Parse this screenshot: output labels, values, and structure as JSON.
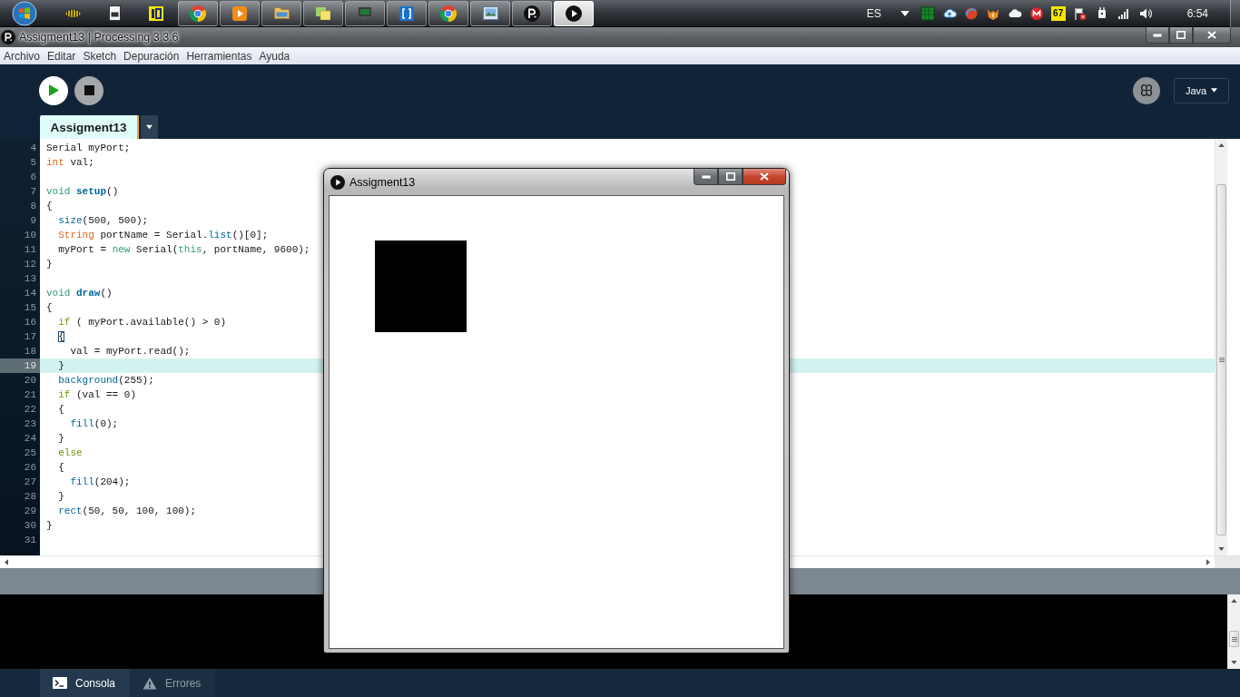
{
  "taskbar": {
    "apps": [
      {
        "running": false,
        "selected": false
      },
      {
        "running": false,
        "selected": false
      },
      {
        "running": false,
        "selected": false
      },
      {
        "running": true,
        "selected": false
      },
      {
        "running": true,
        "selected": false
      },
      {
        "running": true,
        "selected": false
      },
      {
        "running": true,
        "selected": false
      },
      {
        "running": true,
        "selected": false
      },
      {
        "running": true,
        "selected": false
      },
      {
        "running": true,
        "selected": false
      },
      {
        "running": true,
        "selected": false
      },
      {
        "running": true,
        "selected": false
      },
      {
        "running": true,
        "selected": true
      }
    ],
    "tray": {
      "language": "ES",
      "counter": "67",
      "clock": "6:54"
    }
  },
  "window": {
    "title": "Assigment13 | Processing 3.3.6"
  },
  "menu": [
    "Archivo",
    "Editar",
    "Sketch",
    "Depuración",
    "Herramientas",
    "Ayuda"
  ],
  "toolbar": {
    "mode": "Java"
  },
  "tabs": [
    {
      "label": "Assigment13",
      "selected": true
    }
  ],
  "editor": {
    "lines": [
      {
        "number": "4",
        "current": false,
        "tokens": [
          {
            "text": "Serial myPort;",
            "kind": "plain"
          }
        ]
      },
      {
        "number": "5",
        "current": false,
        "tokens": [
          {
            "text": "int",
            "kind": "type"
          },
          {
            "text": " val;",
            "kind": "plain"
          }
        ]
      },
      {
        "number": "6",
        "current": false
      },
      {
        "number": "7",
        "current": false,
        "tokens": [
          {
            "text": "void ",
            "kind": "keyword"
          },
          {
            "text": "setup",
            "kind": "definition"
          },
          {
            "text": "()",
            "kind": "plain"
          }
        ]
      },
      {
        "number": "8",
        "current": false,
        "tokens": [
          {
            "text": "{",
            "kind": "plain"
          }
        ]
      },
      {
        "number": "9",
        "current": false,
        "tokens": [
          {
            "text": "  size",
            "kind": "function"
          },
          {
            "text": "(500, 500);",
            "kind": "plain"
          }
        ]
      },
      {
        "number": "10",
        "current": false,
        "tokens": [
          {
            "text": "  String",
            "kind": "type"
          },
          {
            "text": " portName = Serial.",
            "kind": "plain"
          },
          {
            "text": "list",
            "kind": "function"
          },
          {
            "text": "()[0];",
            "kind": "plain"
          }
        ]
      },
      {
        "number": "11",
        "current": false,
        "tokens": [
          {
            "text": "  myPort = ",
            "kind": "plain"
          },
          {
            "text": "new",
            "kind": "keyword"
          },
          {
            "text": " Serial(",
            "kind": "plain"
          },
          {
            "text": "this",
            "kind": "keyword"
          },
          {
            "text": ", portName, 9600);",
            "kind": "plain"
          }
        ]
      },
      {
        "number": "12",
        "current": false,
        "tokens": [
          {
            "text": "}",
            "kind": "plain"
          }
        ]
      },
      {
        "number": "13",
        "current": false
      },
      {
        "number": "14",
        "current": false,
        "tokens": [
          {
            "text": "void ",
            "kind": "keyword"
          },
          {
            "text": "draw",
            "kind": "definition"
          },
          {
            "text": "()",
            "kind": "plain"
          }
        ]
      },
      {
        "number": "15",
        "current": false,
        "tokens": [
          {
            "text": "{",
            "kind": "plain"
          }
        ]
      },
      {
        "number": "16",
        "current": false,
        "tokens": [
          {
            "text": "  if",
            "kind": "control"
          },
          {
            "text": " ( myPort.available() > 0)",
            "kind": "plain"
          }
        ]
      },
      {
        "number": "17",
        "current": false,
        "tokens": [
          {
            "text": "  {",
            "kind": "match"
          }
        ]
      },
      {
        "number": "18",
        "current": false,
        "tokens": [
          {
            "text": "    val = myPort.read();",
            "kind": "plain"
          }
        ]
      },
      {
        "number": "19",
        "current": true,
        "tokens": [
          {
            "text": "  }",
            "kind": "plain"
          }
        ]
      },
      {
        "number": "20",
        "current": false,
        "tokens": [
          {
            "text": "  background",
            "kind": "function"
          },
          {
            "text": "(255);",
            "kind": "plain"
          }
        ]
      },
      {
        "number": "21",
        "current": false,
        "tokens": [
          {
            "text": "  if",
            "kind": "control"
          },
          {
            "text": " (val == 0)",
            "kind": "plain"
          }
        ]
      },
      {
        "number": "22",
        "current": false,
        "tokens": [
          {
            "text": "  {",
            "kind": "plain"
          }
        ]
      },
      {
        "number": "23",
        "current": false,
        "tokens": [
          {
            "text": "    fill",
            "kind": "function"
          },
          {
            "text": "(0);",
            "kind": "plain"
          }
        ]
      },
      {
        "number": "24",
        "current": false,
        "tokens": [
          {
            "text": "  }",
            "kind": "plain"
          }
        ]
      },
      {
        "number": "25",
        "current": false,
        "tokens": [
          {
            "text": "  else",
            "kind": "control"
          }
        ]
      },
      {
        "number": "26",
        "current": false,
        "tokens": [
          {
            "text": "  {",
            "kind": "plain"
          }
        ]
      },
      {
        "number": "27",
        "current": false,
        "tokens": [
          {
            "text": "    fill",
            "kind": "function"
          },
          {
            "text": "(204);",
            "kind": "plain"
          }
        ]
      },
      {
        "number": "28",
        "current": false,
        "tokens": [
          {
            "text": "  }",
            "kind": "plain"
          }
        ]
      },
      {
        "number": "29",
        "current": false,
        "tokens": [
          {
            "text": "  rect",
            "kind": "function"
          },
          {
            "text": "(50, 50, 100, 100);",
            "kind": "plain"
          }
        ]
      },
      {
        "number": "30",
        "current": false,
        "tokens": [
          {
            "text": "}",
            "kind": "plain"
          }
        ]
      },
      {
        "number": "31",
        "current": false
      }
    ]
  },
  "console_tabs": [
    {
      "label": "Consola",
      "kind": "console",
      "selected": true
    },
    {
      "label": "Errores",
      "kind": "errors",
      "selected": false
    }
  ],
  "sketch_window": {
    "title": "Assigment13"
  }
}
